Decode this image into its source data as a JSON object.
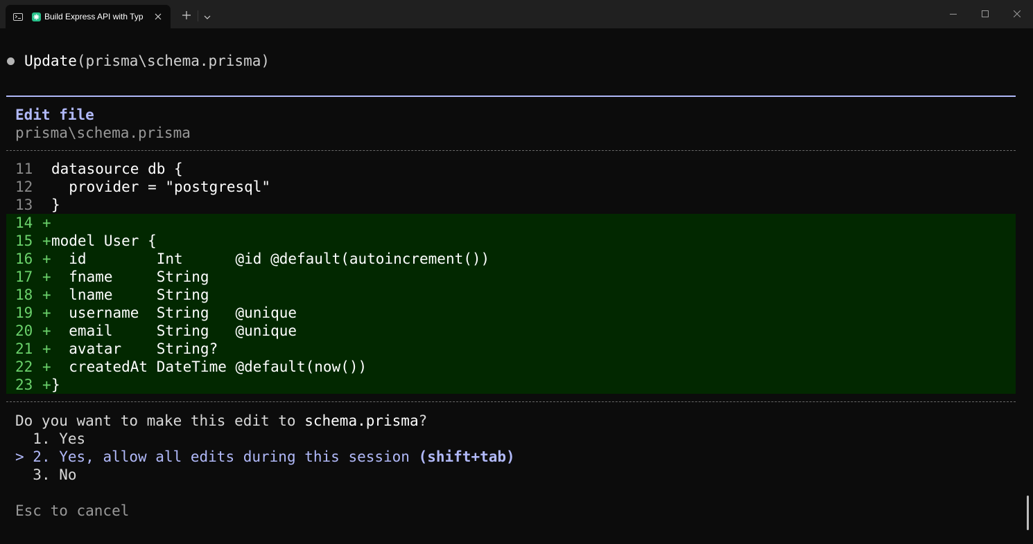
{
  "window": {
    "tab_title": "Build Express API with Typ",
    "tab_icon": "terminal-icon",
    "app_icon": "claude-star-icon",
    "controls": [
      "minimize",
      "maximize",
      "close"
    ]
  },
  "tool_call": {
    "action": "Update",
    "target": "(prisma\\schema.prisma)"
  },
  "edit_panel": {
    "title": "Edit file",
    "path": "prisma\\schema.prisma",
    "accent_color": "#b1b9f9",
    "added_bg_color": "#022800",
    "added_fg_color": "#6bd26b",
    "context_lines": [
      {
        "num": "11",
        "text": "datasource db {"
      },
      {
        "num": "12",
        "text": "  provider = \"postgresql\""
      },
      {
        "num": "13",
        "text": "}"
      }
    ],
    "added_lines": [
      {
        "num": "14",
        "text": ""
      },
      {
        "num": "15",
        "text": "model User {"
      },
      {
        "num": "16",
        "text": "  id        Int      @id @default(autoincrement())"
      },
      {
        "num": "17",
        "text": "  fname     String"
      },
      {
        "num": "18",
        "text": "  lname     String"
      },
      {
        "num": "19",
        "text": "  username  String   @unique"
      },
      {
        "num": "20",
        "text": "  email     String   @unique"
      },
      {
        "num": "21",
        "text": "  avatar    String?"
      },
      {
        "num": "22",
        "text": "  createdAt DateTime @default(now())"
      },
      {
        "num": "23",
        "text": "}"
      }
    ]
  },
  "prompt": {
    "question_prefix": "Do you want to make this edit to ",
    "question_file": "schema.prisma",
    "question_suffix": "?",
    "options": [
      {
        "marker": "  ",
        "label": "1. Yes",
        "hint": ""
      },
      {
        "marker": "> ",
        "label": "2. Yes, allow all edits during this session ",
        "hint": "(shift+tab)"
      },
      {
        "marker": "  ",
        "label": "3. No",
        "hint": ""
      }
    ],
    "selected_index": 1,
    "cancel_hint": "Esc to cancel"
  }
}
